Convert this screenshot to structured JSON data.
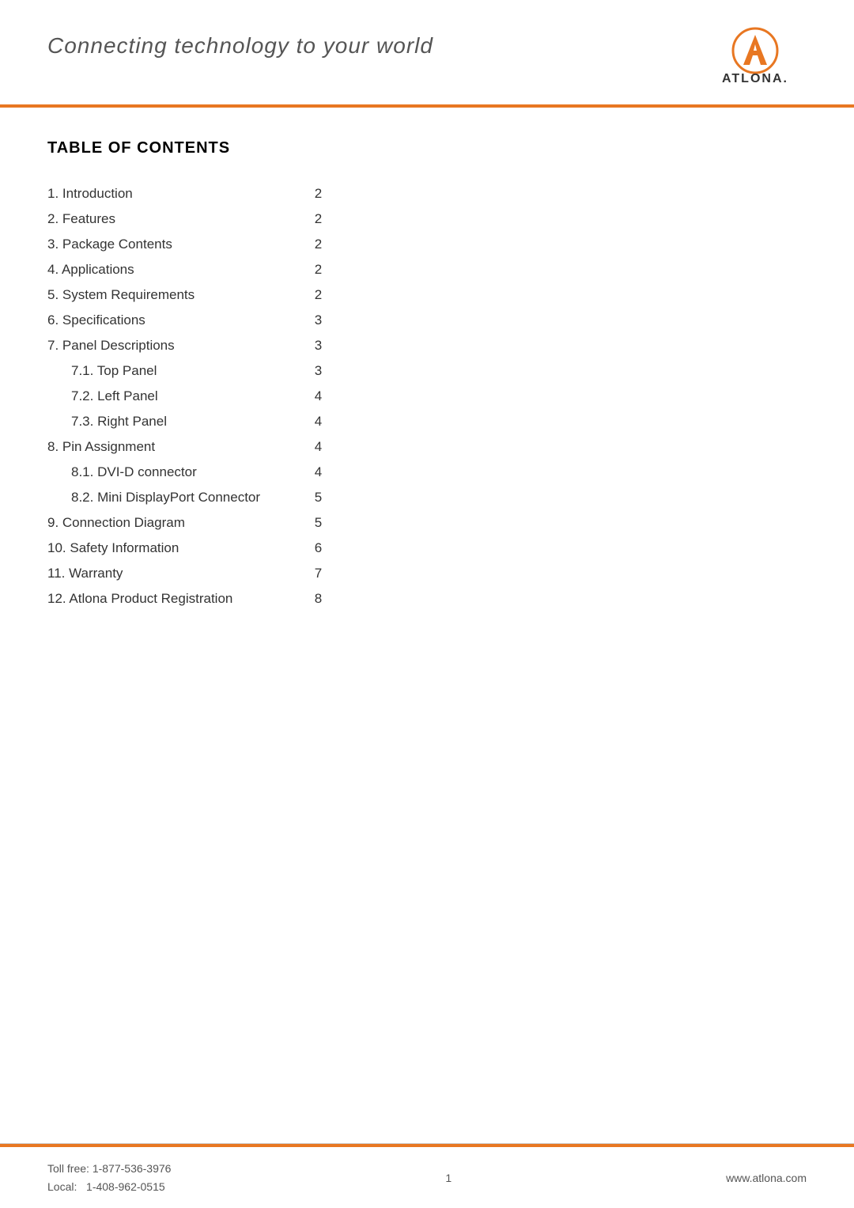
{
  "header": {
    "tagline": "Connecting technology to your world"
  },
  "toc": {
    "title": "TABLE OF CONTENTS",
    "items": [
      {
        "label": "1. Introduction",
        "page": "2",
        "indented": false
      },
      {
        "label": "2. Features",
        "page": "2",
        "indented": false
      },
      {
        "label": "3. Package Contents",
        "page": "2",
        "indented": false
      },
      {
        "label": "4. Applications",
        "page": "2",
        "indented": false
      },
      {
        "label": "5. System Requirements",
        "page": "2",
        "indented": false
      },
      {
        "label": "6. Specifications",
        "page": "3",
        "indented": false
      },
      {
        "label": "7. Panel Descriptions",
        "page": "3",
        "indented": false
      },
      {
        "label": "7.1. Top Panel",
        "page": "3",
        "indented": true
      },
      {
        "label": "7.2. Left Panel",
        "page": "4",
        "indented": true
      },
      {
        "label": "7.3. Right Panel",
        "page": "4",
        "indented": true
      },
      {
        "label": "8. Pin Assignment",
        "page": "4",
        "indented": false
      },
      {
        "label": "8.1. DVI-D connector",
        "page": "4",
        "indented": true
      },
      {
        "label": "8.2. Mini DisplayPort Connector",
        "page": "5",
        "indented": true
      },
      {
        "label": "9. Connection Diagram",
        "page": "5",
        "indented": false
      },
      {
        "label": "10. Safety Information",
        "page": "6",
        "indented": false
      },
      {
        "label": "11. Warranty",
        "page": "7",
        "indented": false
      },
      {
        "label": "12. Atlona Product Registration",
        "page": "8",
        "indented": false
      }
    ]
  },
  "footer": {
    "toll_free_label": "Toll free:",
    "toll_free_number": "1-877-536-3976",
    "local_label": "Local:",
    "local_number": "1-408-962-0515",
    "page_number": "1",
    "website": "www.atlona.com"
  },
  "colors": {
    "accent": "#e87722",
    "text_primary": "#333333",
    "text_muted": "#555555"
  }
}
